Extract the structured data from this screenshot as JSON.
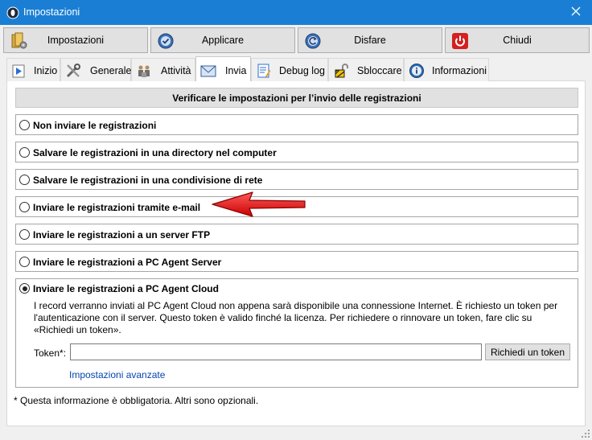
{
  "window": {
    "title": "Impostazioni",
    "app_icon": "app-logo-icon",
    "close_icon": "close-icon"
  },
  "toolbar": [
    {
      "label": "Impostazioni",
      "icon": "settings-icon"
    },
    {
      "label": "Applicare",
      "icon": "apply-icon"
    },
    {
      "label": "Disfare",
      "icon": "undo-icon"
    },
    {
      "label": "Chiudi",
      "icon": "power-icon"
    }
  ],
  "tabs": [
    {
      "label": "Inizio",
      "icon": "play-icon"
    },
    {
      "label": "Generale",
      "icon": "tools-icon"
    },
    {
      "label": "Attività",
      "icon": "users-icon"
    },
    {
      "label": "Invia",
      "icon": "envelope-icon"
    },
    {
      "label": "Debug log",
      "icon": "log-icon"
    },
    {
      "label": "Sbloccare",
      "icon": "unlock-icon"
    },
    {
      "label": "Informazioni",
      "icon": "info-icon"
    }
  ],
  "active_tab": "Invia",
  "panel": {
    "header": "Verificare le impostazioni per l’invio delle registrazioni",
    "options": [
      {
        "label": "Non inviare le registrazioni",
        "checked": false
      },
      {
        "label": "Salvare le registrazioni in una directory nel computer",
        "checked": false
      },
      {
        "label": "Salvare le registrazioni in una condivisione di rete",
        "checked": false
      },
      {
        "label": "Inviare le registrazioni tramite e-mail",
        "checked": false
      },
      {
        "label": "Inviare le registrazioni a un server FTP",
        "checked": false
      },
      {
        "label": "Inviare le registrazioni a PC Agent Server",
        "checked": false
      }
    ],
    "cloud": {
      "label": "Inviare le registrazioni a PC Agent Cloud",
      "checked": true,
      "description": "I record verranno inviati al PC Agent Cloud non appena sarà disponibile una connessione Internet. È richiesto un token per l'autenticazione con il server. Questo token è valido finché la licenza. Per richiedere o rinnovare un token, fare clic su «Richiedi un token».",
      "token_label": "Token*:",
      "token_value": "",
      "token_button": "Richiedi un token",
      "advanced_link": "Impostazioni avanzate"
    },
    "footnote": "* Questa informazione è obbligatoria. Altri sono opzionali."
  },
  "colors": {
    "titlebar": "#1a7fd4",
    "annotation_arrow": "#e81010",
    "link": "#0645ad"
  }
}
